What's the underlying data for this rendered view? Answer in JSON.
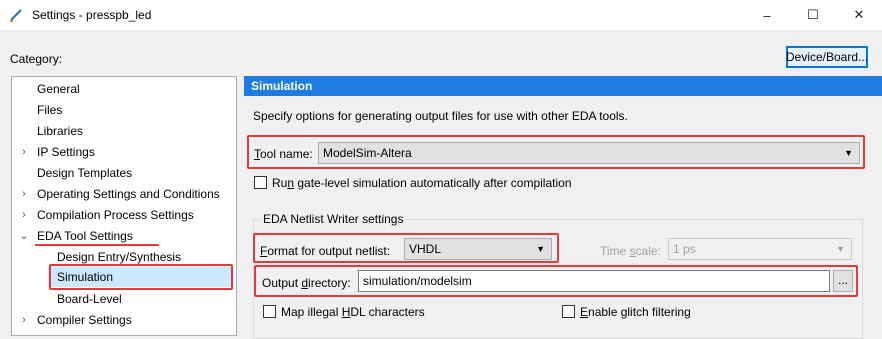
{
  "window": {
    "title": "Settings - presspb_led"
  },
  "header": {
    "category_label": "Category:",
    "device_button": "Device/Board..."
  },
  "tree": {
    "items": [
      {
        "label": "General"
      },
      {
        "label": "Files"
      },
      {
        "label": "Libraries"
      },
      {
        "label": "IP Settings"
      },
      {
        "label": "Design Templates"
      },
      {
        "label": "Operating Settings and Conditions"
      },
      {
        "label": "Compilation Process Settings"
      },
      {
        "label": "EDA Tool Settings"
      },
      {
        "label": "Design Entry/Synthesis"
      },
      {
        "label": "Simulation"
      },
      {
        "label": "Board-Level"
      },
      {
        "label": "Compiler Settings"
      }
    ]
  },
  "simulation": {
    "header": "Simulation",
    "description": "Specify options for generating output files for use with other EDA tools.",
    "tool_name_label_u": "T",
    "tool_name_label_rest": "ool name:",
    "tool_name_value": "ModelSim-Altera",
    "run_gate_label_a": "Ru",
    "run_gate_label_u": "n",
    "run_gate_label_b": " gate-level simulation automatically after compilation",
    "netlist_group_title": "EDA Netlist Writer settings",
    "format_label_u": "F",
    "format_label_rest": "ormat for output netlist:",
    "format_value": "VHDL",
    "time_scale_label_a": "Time ",
    "time_scale_label_u": "s",
    "time_scale_label_b": "cale:",
    "time_scale_value": "1 ps",
    "output_dir_label_a": "Output ",
    "output_dir_label_u": "d",
    "output_dir_label_b": "irectory:",
    "output_dir_value": "simulation/modelsim",
    "browse_button": "...",
    "map_hdl_label_a": "Map illegal ",
    "map_hdl_label_u": "H",
    "map_hdl_label_b": "DL characters",
    "glitch_label_u": "E",
    "glitch_label_rest": "nable glitch filtering"
  }
}
